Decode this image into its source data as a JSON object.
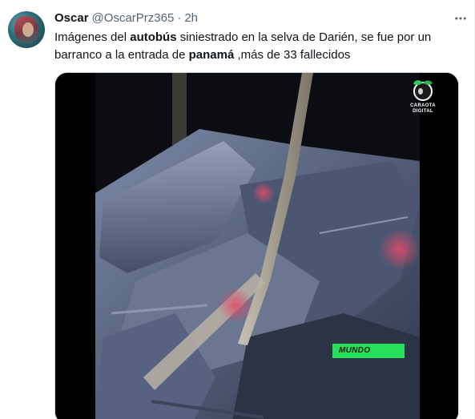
{
  "tweet": {
    "author_name": "Oscar",
    "author_handle": "@OscarPrz365",
    "separator": "·",
    "time": "2h",
    "text_parts": {
      "p1": "Imágenes del ",
      "b1": "autobús",
      "p2": " siniestrado en la selva de Darién, se fue por un barranco a la entrada de ",
      "b2": "panamá",
      "p3": " ,más de 33 fallecidos"
    }
  },
  "media": {
    "logo_line1": "CARAOTA",
    "logo_line2": "DIGITAL",
    "badge_label": "MUNDO",
    "badge_color": "#27e05a"
  },
  "icons": {
    "more": "more-options-icon",
    "logo": "caraota-logo-icon"
  }
}
